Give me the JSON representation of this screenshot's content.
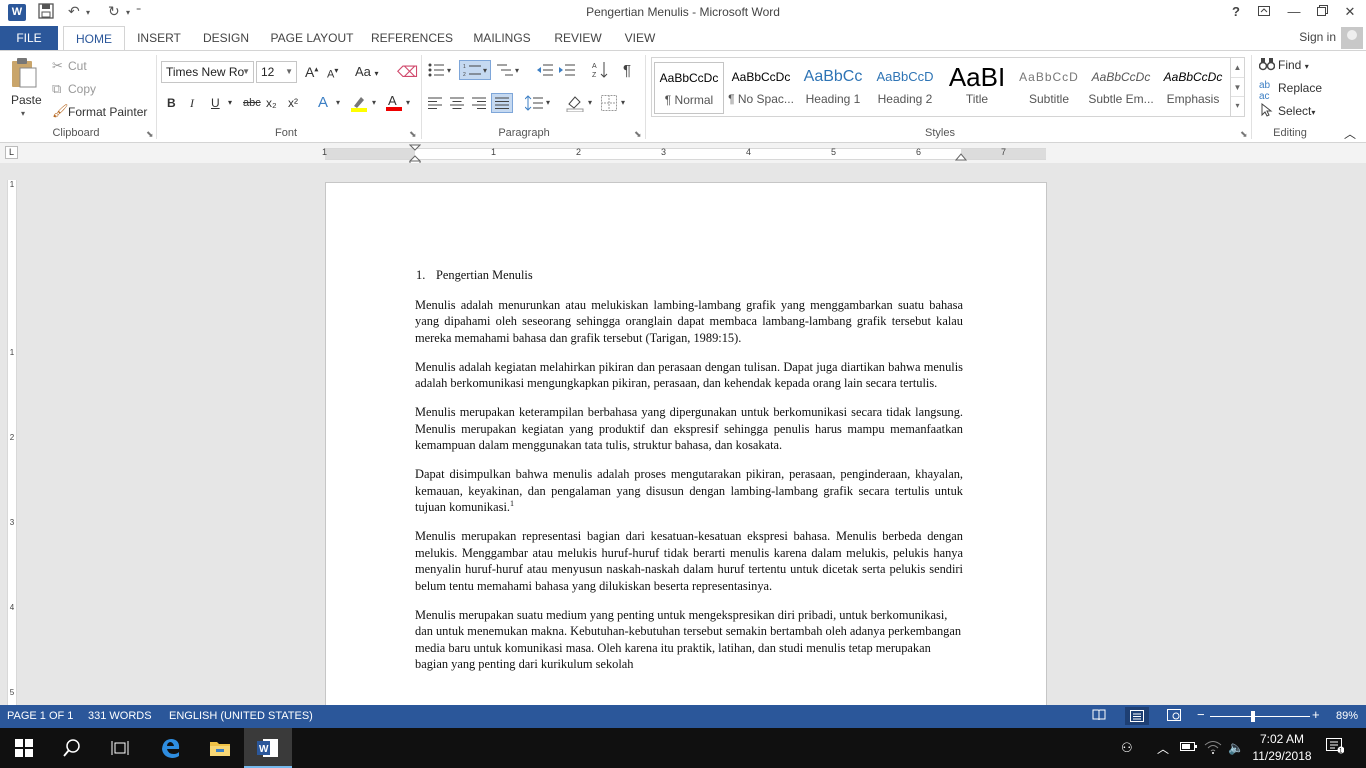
{
  "window": {
    "title": "Pengertian Menulis - Microsoft Word",
    "help": "?",
    "app_icon_letter": "W"
  },
  "tabs": {
    "file": "FILE",
    "home": "HOME",
    "insert": "INSERT",
    "design": "DESIGN",
    "page_layout": "PAGE LAYOUT",
    "references": "REFERENCES",
    "mailings": "MAILINGS",
    "review": "REVIEW",
    "view": "VIEW",
    "sign_in": "Sign in"
  },
  "ribbon": {
    "clipboard": {
      "label": "Clipboard",
      "paste": "Paste",
      "cut": "Cut",
      "copy": "Copy",
      "format_painter": "Format Painter"
    },
    "font": {
      "label": "Font",
      "font_name": "Times New Ro",
      "font_size": "12",
      "bold": "B",
      "italic": "I",
      "underline": "U",
      "strike": "abc",
      "subscript": "x₂",
      "superscript": "x²",
      "grow": "A",
      "shrink": "A",
      "change_case": "Aa"
    },
    "paragraph": {
      "label": "Paragraph"
    },
    "styles": {
      "label": "Styles",
      "items": [
        {
          "preview": "AaBbCcDc",
          "label": "¶ Normal"
        },
        {
          "preview": "AaBbCcDc",
          "label": "¶ No Spac..."
        },
        {
          "preview": "AaBbCc",
          "label": "Heading 1"
        },
        {
          "preview": "AaBbCcD",
          "label": "Heading 2"
        },
        {
          "preview": "AaBI",
          "label": "Title"
        },
        {
          "preview": "AaBbCcD",
          "label": "Subtitle"
        },
        {
          "preview": "AaBbCcDc",
          "label": "Subtle Em..."
        },
        {
          "preview": "AaBbCcDc",
          "label": "Emphasis"
        }
      ]
    },
    "editing": {
      "label": "Editing",
      "find": "Find",
      "replace": "Replace",
      "select": "Select"
    }
  },
  "ruler": {
    "numbers": [
      "1",
      "1",
      "2",
      "3",
      "4",
      "5",
      "6",
      "7"
    ],
    "vnumbers": [
      "1",
      "1",
      "2",
      "3",
      "4",
      "5"
    ]
  },
  "document": {
    "heading_number": "1.",
    "heading_text": "Pengertian Menulis",
    "paragraphs": [
      "Menulis adalah menurunkan atau melukiskan lambing-lambang grafik yang menggambarkan suatu bahasa yang dipahami oleh seseorang sehingga oranglain dapat membaca lambang-lambang grafik tersebut kalau mereka memahami bahasa dan grafik tersebut (Tarigan, 1989:15).",
      "Menulis adalah kegiatan melahirkan pikiran dan perasaan dengan tulisan. Dapat juga diartikan bahwa menulis adalah berkomunikasi mengungkapkan pikiran, perasaan, dan kehendak kepada orang lain secara tertulis.",
      "Menulis merupakan keterampilan berbahasa yang dipergunakan untuk berkomunikasi secara tidak langsung. Menulis merupakan kegiatan yang produktif dan ekspresif sehingga penulis harus mampu memanfaatkan kemampuan dalam menggunakan tata tulis, struktur bahasa, dan kosakata.",
      "Dapat disimpulkan bahwa menulis adalah proses mengutarakan pikiran, perasaan, penginderaan, khayalan, kemauan, keyakinan, dan pengalaman yang disusun dengan lambing-lambang grafik secara tertulis untuk tujuan komunikasi.",
      "Menulis merupakan representasi bagian dari kesatuan-kesatuan ekspresi bahasa. Menulis berbeda dengan melukis. Menggambar atau melukis huruf-huruf tidak berarti menulis karena dalam melukis, pelukis hanya menyalin huruf-huruf atau menyusun naskah-naskah dalam huruf tertentu untuk dicetak serta pelukis sendiri belum tentu memahami bahasa yang dilukiskan beserta representasinya.",
      "Menulis merupakan suatu medium yang penting untuk mengekspresikan diri pribadi, untuk berkomunikasi, dan untuk menemukan makna. Kebutuhan-kebutuhan tersebut semakin bertambah oleh adanya perkembangan media baru untuk komunikasi masa. Oleh karena itu praktik, latihan, dan studi menulis tetap merupakan bagian yang penting dari kurikulum sekolah"
    ],
    "footnote_ref": "1"
  },
  "status": {
    "page": "PAGE 1 OF 1",
    "words": "331 WORDS",
    "language": "ENGLISH (UNITED STATES)",
    "zoom": "89%",
    "zoom_minus": "−",
    "zoom_plus": "+"
  },
  "taskbar": {
    "time": "7:02 AM",
    "date": "11/29/2018"
  },
  "colors": {
    "accent": "#2b579a",
    "taskbar": "#101010"
  }
}
